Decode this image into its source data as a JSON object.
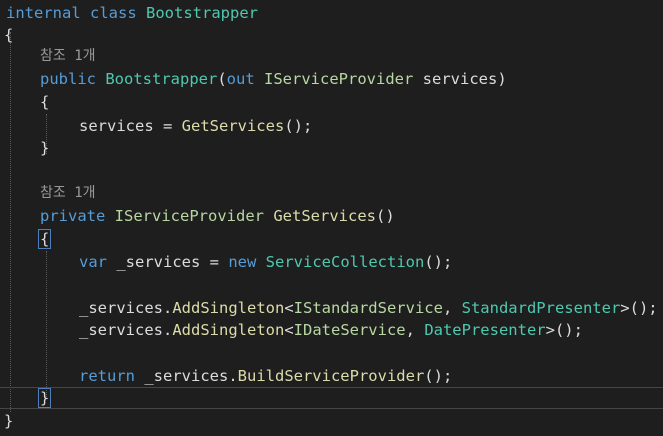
{
  "editor": {
    "class_line": {
      "kw": "internal class",
      "name": "Bootstrapper"
    },
    "open_brace": "{",
    "close_brace": "}",
    "ctor": {
      "codelens": "참조 1개",
      "kw_public": "public",
      "name": "Bootstrapper",
      "paren_open": "(",
      "kw_out": "out",
      "param_type": "IServiceProvider",
      "param_name": " services",
      "paren_close": ")",
      "open": "{",
      "body_left": "services = ",
      "body_call": "GetServices",
      "body_end": "();",
      "close": "}"
    },
    "method": {
      "codelens": "참조 1개",
      "kw_private": "private",
      "return_type": "IServiceProvider",
      "name": "GetServices",
      "parens": "()",
      "open": "{",
      "l1_var": "var",
      "l1_mid": " _services = ",
      "l1_new": "new",
      "l1_type": "ServiceCollection",
      "l1_end": "();",
      "l2_obj": "_services.",
      "l2_call": "AddSingleton",
      "l2_lt": "<",
      "l2_iface": "IStandardService",
      "l2_comma": ", ",
      "l2_impl": "StandardPresenter",
      "l2_end": ">();",
      "l3_obj": "_services.",
      "l3_call": "AddSingleton",
      "l3_lt": "<",
      "l3_iface": "IDateService",
      "l3_comma": ", ",
      "l3_impl": "DatePresenter",
      "l3_end": ">();",
      "l4_return": "return",
      "l4_obj": " _services.",
      "l4_call": "BuildServiceProvider",
      "l4_end": "();",
      "close": "}"
    }
  },
  "colors": {
    "background": "#1e1e1e",
    "keyword": "#569cd6",
    "type": "#4ec9b0",
    "interface": "#b8d7a3",
    "method": "#dcdcaa",
    "plain": "#dcdcdc",
    "codelens": "#999999"
  }
}
